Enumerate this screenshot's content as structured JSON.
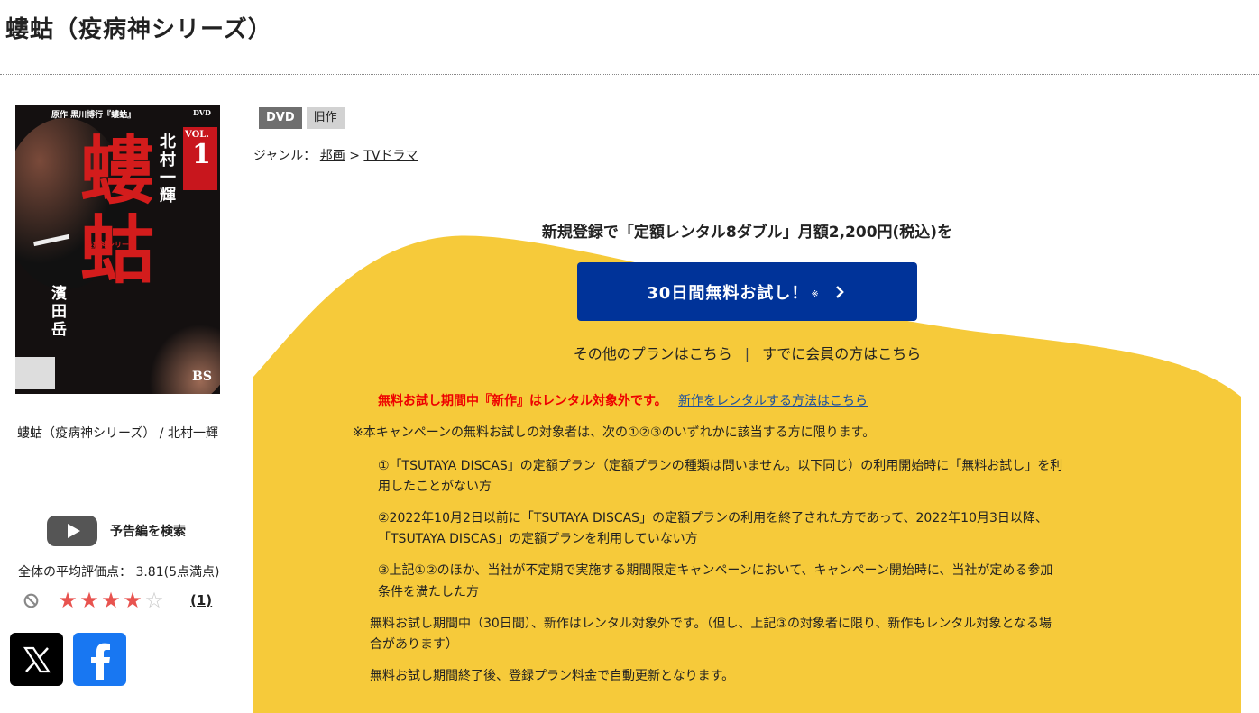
{
  "page": {
    "title": "螻蛄（疫病神シリーズ）"
  },
  "product": {
    "cover": {
      "title_art": "螻蛄",
      "series_art": "疫病神シリーズ",
      "header_art": "原作 黒川博行『螻蛄』",
      "vol_art": "VOL.",
      "vol_number": "1",
      "cast_1": "北村一輝",
      "cast_2": "濱田岳",
      "network_art": "BS",
      "format_art": "DVD"
    },
    "caption": "螻蛄（疫病神シリーズ） / 北村一輝",
    "trailer_label": "予告編を検索",
    "average_rating_label": "全体の平均評価点： 3.81(5点満点)",
    "rating": {
      "value": 3.81,
      "max": 5,
      "filled_stars": 4,
      "review_count": "(1)"
    },
    "social": {
      "x_icon": "x-logo-icon",
      "facebook_icon": "facebook-logo-icon"
    }
  },
  "badges": [
    "DVD",
    "旧作"
  ],
  "genre": {
    "label": "ジャンル：",
    "items": [
      "邦画",
      "TVドラマ"
    ],
    "separator": ">"
  },
  "promo": {
    "headline": "新規登録で「定額レンタル8ダブル」月額2,200円(税込)を",
    "cta_label": "30日間無料お試し！",
    "cta_note": "※",
    "other_plans": "その他のプランはこちら",
    "separator": "|",
    "members": "すでに会員の方はこちら",
    "notice_red": "無料お試し期間中『新作』はレンタル対象外です。",
    "notice_link": "新作をレンタルする方法はこちら",
    "terms_intro": "※本キャンペーンの無料お試しの対象者は、次の①②③のいずれかに該当する方に限ります。",
    "term_1a": "①「TSUTAYA DISCAS」の定額プラン（定額プランの種類は問いません。以下同じ）の利用開始時に「無料お試し」を利",
    "term_1b": "用したことがない方",
    "term_2a": "②2022年10月2日以前に「TSUTAYA DISCAS」の定額プランの利用を終了された方であって、2022年10月3日以降、",
    "term_2b": "「TSUTAYA DISCAS」の定額プランを利用していない方",
    "term_3a": "③上記①②のほか、当社が不定期で実施する期間限定キャンペーンにおいて、キャンペーン開始時に、当社が定める参加",
    "term_3b": "条件を満たした方",
    "note_1a": "無料お試し期間中（30日間）、新作はレンタル対象外です。（但し、上記③の対象者に限り、新作もレンタル対象となる場",
    "note_1b": "合があります）",
    "note_2": "無料お試し期間終了後、登録プラン料金で自動更新となります。"
  },
  "colors": {
    "promo_bg": "#f6ca3a",
    "cta_bg": "#003399",
    "notice_red": "#ee0000",
    "link_blue": "#1a4fa0",
    "star": "#e8534f",
    "badge_dvd": "#6f6f6f",
    "badge_old": "#d2d2d2",
    "facebook": "#1877f2"
  }
}
